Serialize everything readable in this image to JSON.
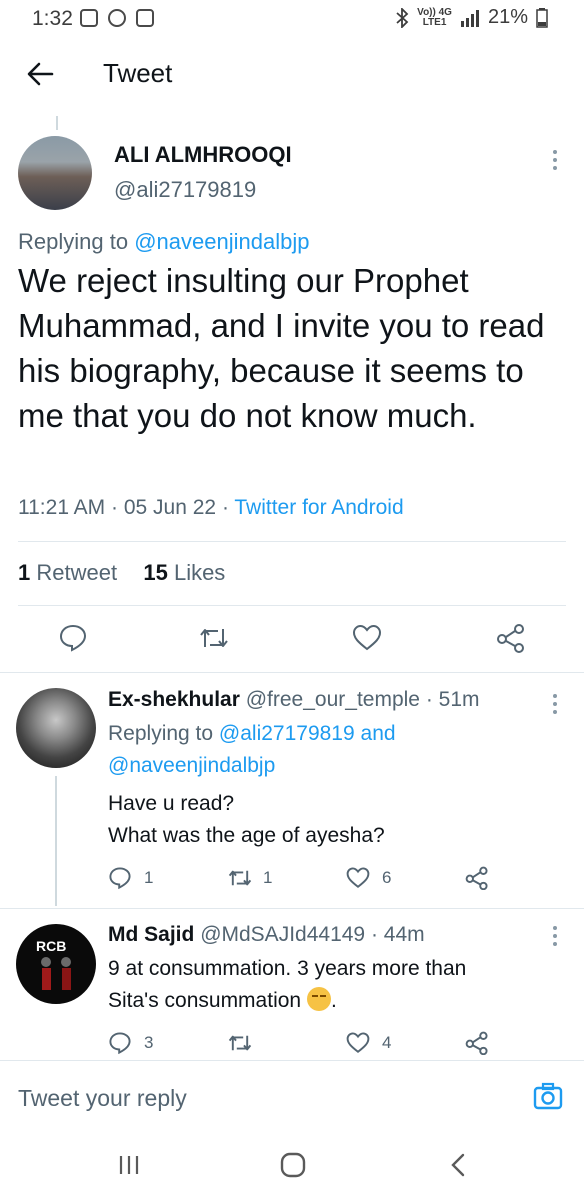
{
  "status_bar": {
    "time": "1:32",
    "network": "Vo)) 4G",
    "network_sub": "LTE1",
    "battery": "21%"
  },
  "header": {
    "title": "Tweet"
  },
  "tweet": {
    "name": "ALI ALMHROOQI",
    "handle": "@ali27179819",
    "replying_prefix": "Replying to",
    "replying_to": "@naveenjindalbjp",
    "body": "We reject insulting our Prophet Muhammad, and I invite you to read his biography, because it seems to me that you do not know much.",
    "time": "11:21 AM",
    "date": "05 Jun 22",
    "source": "Twitter for Android",
    "retweets_count": "1",
    "retweets_label": "Retweet",
    "likes_count": "15",
    "likes_label": "Likes"
  },
  "replies": [
    {
      "name": "Ex-shekhular",
      "handle": "@free_our_temple",
      "age": "51m",
      "replying_prefix": "Replying to",
      "replying_to_1": "@ali27179819",
      "replying_and": "and",
      "replying_to_2": "@naveenjindalbjp",
      "line1": "Have u read?",
      "line2": "What was the age of ayesha?",
      "reply_count": "1",
      "retweet_count": "1",
      "like_count": "6"
    },
    {
      "name": "Md Sajid",
      "handle": "@MdSAJId44149",
      "age": "44m",
      "avatar_text": "RCB",
      "line1": "9 at consummation. 3 years more than",
      "line2": "Sita's consummation",
      "line2_end": ".",
      "reply_count": "3",
      "like_count": "4"
    }
  ],
  "compose": {
    "placeholder": "Tweet your reply"
  },
  "colors": {
    "accent": "#1d9bf0",
    "text": "#0f1419",
    "secondary": "#536471"
  }
}
